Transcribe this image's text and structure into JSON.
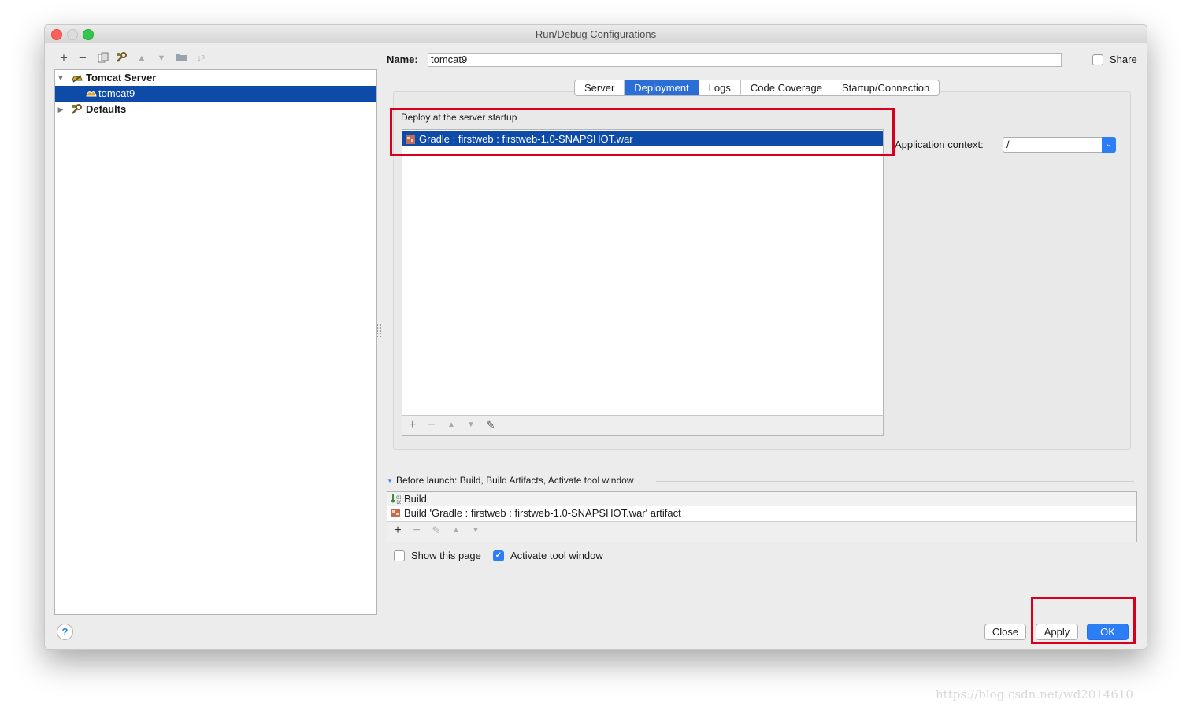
{
  "window": {
    "title": "Run/Debug Configurations"
  },
  "tree": {
    "items": [
      {
        "label": "Tomcat Server",
        "expanded": true
      },
      {
        "label": "tomcat9",
        "selected": true
      },
      {
        "label": "Defaults",
        "expanded": false
      }
    ]
  },
  "form": {
    "name_label": "Name:",
    "name_value": "tomcat9",
    "share_label": "Share",
    "share_checked": false
  },
  "tabs": [
    {
      "label": "Server",
      "active": false
    },
    {
      "label": "Deployment",
      "active": true
    },
    {
      "label": "Logs",
      "active": false
    },
    {
      "label": "Code Coverage",
      "active": false
    },
    {
      "label": "Startup/Connection",
      "active": false
    }
  ],
  "deployment": {
    "group_label": "Deploy at the server startup",
    "artifacts": [
      "Gradle : firstweb : firstweb-1.0-SNAPSHOT.war"
    ],
    "app_context_label": "Application context:",
    "app_context_value": "/"
  },
  "before_launch": {
    "header": "Before launch: Build, Build Artifacts, Activate tool window",
    "items": [
      "Build",
      "Build 'Gradle : firstweb : firstweb-1.0-SNAPSHOT.war' artifact"
    ]
  },
  "options": {
    "show_page_label": "Show this page",
    "show_page_checked": false,
    "activate_tool_label": "Activate tool window",
    "activate_tool_checked": true
  },
  "buttons": {
    "close": "Close",
    "apply": "Apply",
    "ok": "OK",
    "help": "?"
  },
  "watermark": "https://blog.csdn.net/wd2014610",
  "colors": {
    "selection": "#0e4aa8",
    "accent": "#2d7df6",
    "highlight_box": "#d6001c"
  }
}
